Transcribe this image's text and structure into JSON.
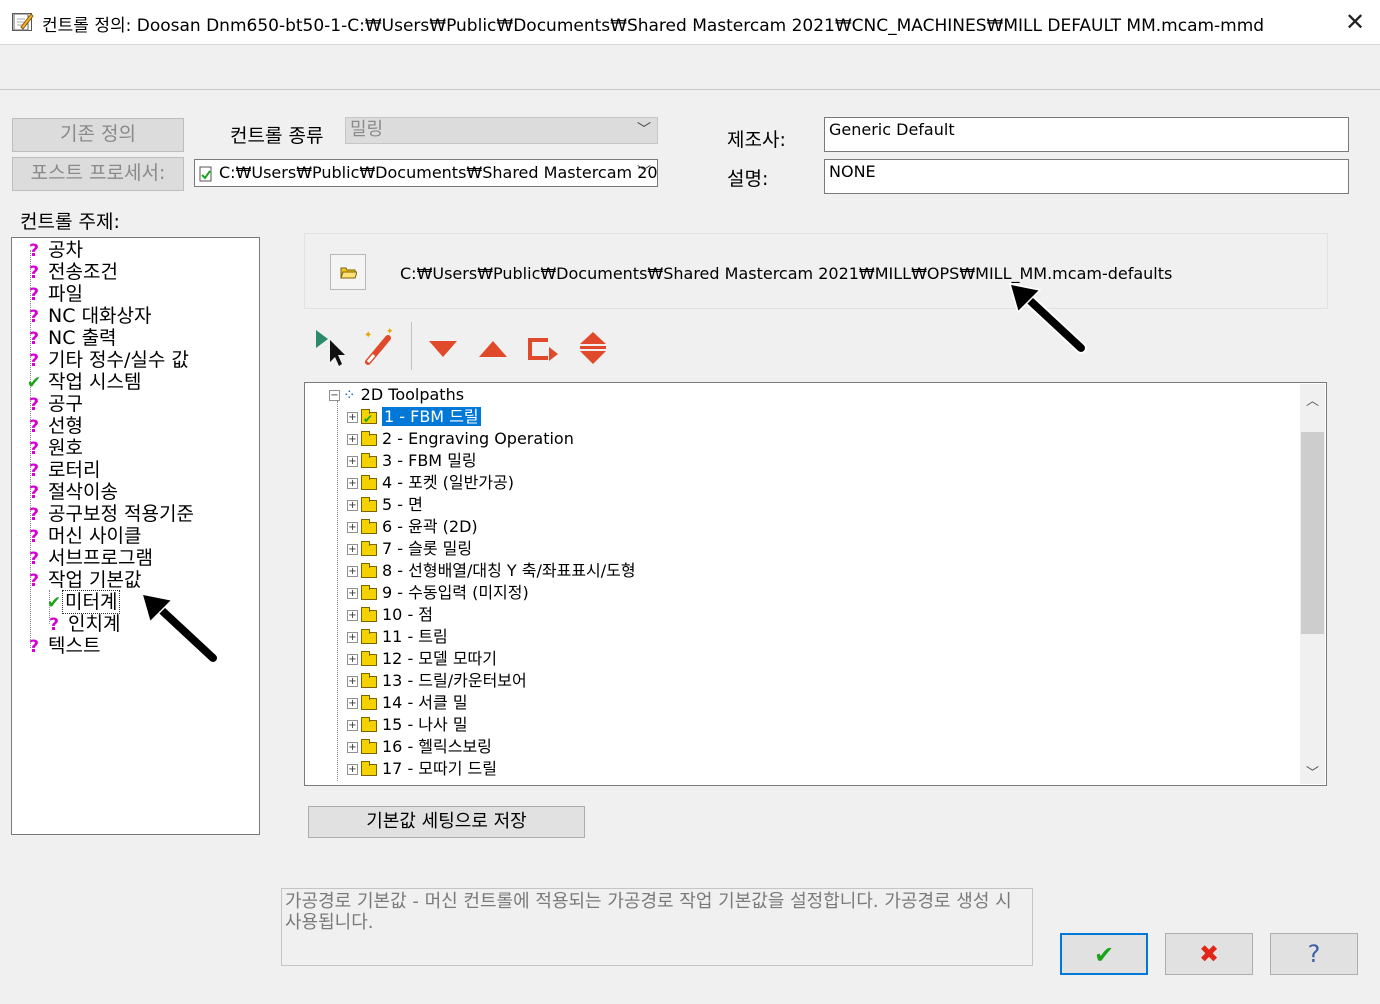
{
  "window": {
    "title": "컨트롤 정의: Doosan Dnm650-bt50-1-C:₩Users₩Public₩Documents₩Shared Mastercam 2021₩CNC_MACHINES₩MILL DEFAULT MM.mcam-mmd",
    "close_label": "✕"
  },
  "top": {
    "existing_def_label": "기존 정의",
    "post_processor_label": "포스트 프로세서:",
    "control_type_label": "컨트롤 종류",
    "control_type_value": "밀링",
    "post_path": "C:₩Users₩Public₩Documents₩Shared Mastercam 20",
    "manufacturer_label": "제조사:",
    "manufacturer_value": "Generic Default",
    "description_label": "설명:",
    "description_value": "NONE"
  },
  "topics": {
    "header": "컨트롤 주제:",
    "items": [
      {
        "label": "공차",
        "status": "?"
      },
      {
        "label": "전송조건",
        "status": "?"
      },
      {
        "label": "파일",
        "status": "?"
      },
      {
        "label": "NC 대화상자",
        "status": "?"
      },
      {
        "label": "NC 출력",
        "status": "?"
      },
      {
        "label": "기타 정수/실수 값",
        "status": "?"
      },
      {
        "label": "작업 시스템",
        "status": "✔"
      },
      {
        "label": "공구",
        "status": "?"
      },
      {
        "label": "선형",
        "status": "?"
      },
      {
        "label": "원호",
        "status": "?"
      },
      {
        "label": "로터리",
        "status": "?"
      },
      {
        "label": "절삭이송",
        "status": "?"
      },
      {
        "label": "공구보정 적용기준",
        "status": "?"
      },
      {
        "label": "머신 사이클",
        "status": "?"
      },
      {
        "label": "서브프로그램",
        "status": "?"
      },
      {
        "label": "작업 기본값",
        "status": "?"
      },
      {
        "label": "미터계",
        "status": "✔"
      },
      {
        "label": "인치계",
        "status": "?"
      },
      {
        "label": "텍스트",
        "status": "?"
      }
    ]
  },
  "defaults_file": {
    "path": "C:₩Users₩Public₩Documents₩Shared Mastercam 2021₩MILL₩OPS₩MILL_MM.mcam-defaults"
  },
  "ops_tree": {
    "root": "2D Toolpaths",
    "items": [
      "1 - FBM 드릴",
      "2 - Engraving Operation",
      "3 - FBM 밀링",
      "4 - 포켓 (일반가공)",
      "5 - 면",
      "6 - 윤곽 (2D)",
      "7 - 슬롯 밀링",
      "8 - 선형배열/대칭 Y 축/좌표표시/도형",
      "9 - 수동입력 (미지정)",
      "10 - 점",
      "11 - 트림",
      "12 - 모델 모따기",
      "13 - 드릴/카운터보어",
      "14 - 서클 밀",
      "15 - 나사 밀",
      "16 - 헬릭스보링",
      "17 - 모따기 드릴"
    ]
  },
  "save_defaults_label": "기본값 세팅으로 저장",
  "help_text": "가공경로 기본값 - 머신 컨트롤에 적용되는 가공경로 작업 기본값을 설정합니다. 가공경로 생성 시 사용됩니다.",
  "buttons": {
    "ok": "✔",
    "cancel": "✖",
    "help": "?"
  },
  "colors": {
    "question": "#d600d6",
    "check": "#19a419",
    "selection": "#0078d7",
    "tool_red": "#e04a2a"
  }
}
